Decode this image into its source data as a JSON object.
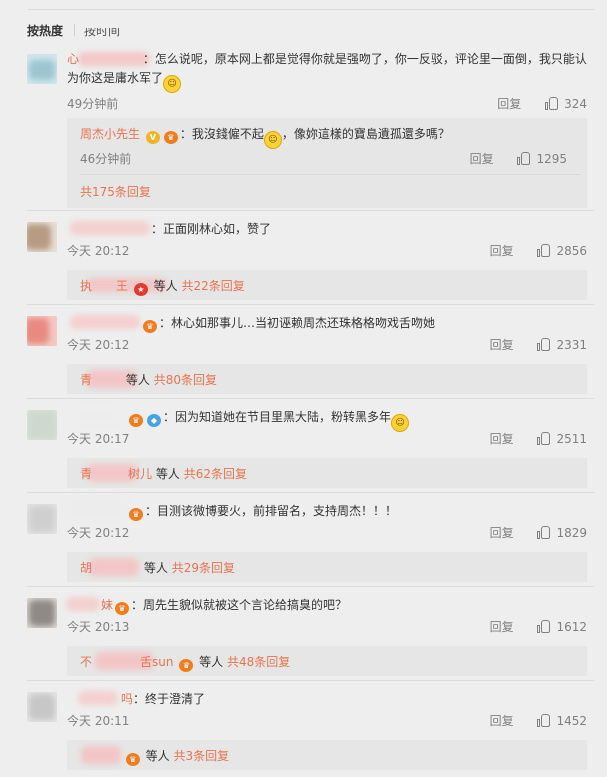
{
  "tabs": {
    "hot": "按热度",
    "time": "按时间"
  },
  "reply_label": "回复",
  "comments": [
    {
      "username": "心",
      "text": "：怎么说呢，原本网上都是觉得你就是强吻了，你一反驳，评论里一面倒，我只能认为你这是庸水军了",
      "time": "49分钟前",
      "likes": "324",
      "subreply": {
        "username": "周杰小先生",
        "text": "：我沒錢僱不起",
        "text2": "，像妳這樣的寶島遺孤還多嗎？",
        "time": "46分钟前",
        "likes": "1295"
      },
      "more": "共175条回复"
    },
    {
      "username": "",
      "text": "：正面刚林心如，赞了",
      "time": "今天 20:12",
      "likes": "2856",
      "more_name": "执　　王",
      "more_mid": "等人",
      "more_count": "共22条回复"
    },
    {
      "username": "",
      "text": "：林心如那事儿…当初诬赖周杰还珠格格吻戏舌吻她",
      "time": "今天 20:12",
      "likes": "2331",
      "more_name": "青",
      "more_mid": "等人",
      "more_count": "共80条回复"
    },
    {
      "username": "",
      "text": "：因为知道她在节目里黑大陆，粉转黑多年",
      "time": "今天 20:17",
      "likes": "2511",
      "more_name": "青　　　树儿",
      "more_mid": "等人",
      "more_count": "共62条回复"
    },
    {
      "username": "",
      "text": "：目测该微博要火，前排留名，支持周杰！！！",
      "time": "今天 20:12",
      "likes": "1829",
      "more_name": "胡",
      "more_mid": "等人",
      "more_count": "共29条回复"
    },
    {
      "username": "妹",
      "text": "：周先生貌似就被这个言论给搞臭的吧？",
      "time": "今天 20:13",
      "likes": "1612",
      "more_name": "不　　　　舌sun",
      "more_mid": "等人",
      "more_count": "共48条回复"
    },
    {
      "username": "吗",
      "text": "：终于澄清了",
      "time": "今天 20:11",
      "likes": "1452",
      "more_name": "",
      "more_mid": "等人",
      "more_count": "共3条回复"
    }
  ]
}
